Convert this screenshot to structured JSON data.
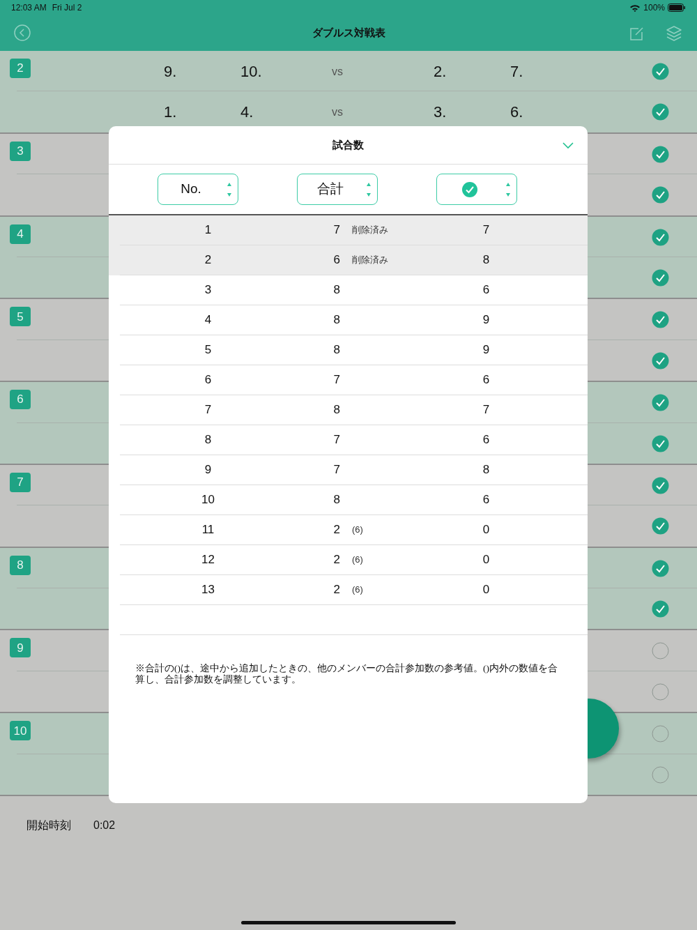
{
  "status_bar": {
    "time": "12:03 AM",
    "date": "Fri Jul 2",
    "battery": "100%"
  },
  "nav": {
    "title": "ダブルス対戦表"
  },
  "matches": [
    {
      "number": "2",
      "shaded": true,
      "rows": [
        {
          "players": [
            "9.",
            "10."
          ],
          "vs": "vs",
          "opponents": [
            "2.",
            "7."
          ],
          "done": true
        },
        {
          "players": [
            "1.",
            "4."
          ],
          "vs": "vs",
          "opponents": [
            "3.",
            "6."
          ],
          "done": true
        }
      ]
    },
    {
      "number": "3",
      "shaded": false,
      "rows": [
        {
          "done": true
        },
        {
          "done": true
        }
      ]
    },
    {
      "number": "4",
      "shaded": true,
      "rows": [
        {
          "done": true
        },
        {
          "done": true
        }
      ]
    },
    {
      "number": "5",
      "shaded": false,
      "rows": [
        {
          "done": true
        },
        {
          "done": true
        }
      ]
    },
    {
      "number": "6",
      "shaded": true,
      "rows": [
        {
          "done": true
        },
        {
          "done": true
        }
      ]
    },
    {
      "number": "7",
      "shaded": false,
      "rows": [
        {
          "done": true
        },
        {
          "done": true
        }
      ]
    },
    {
      "number": "8",
      "shaded": true,
      "rows": [
        {
          "done": true
        },
        {
          "done": true
        }
      ]
    },
    {
      "number": "9",
      "shaded": false,
      "rows": [
        {
          "done": false
        },
        {
          "done": false
        }
      ]
    },
    {
      "number": "10",
      "shaded": true,
      "rows": [
        {
          "done": false
        },
        {
          "done": false
        }
      ]
    }
  ],
  "footer": {
    "label": "開始時刻",
    "value": "0:02"
  },
  "dialog": {
    "title": "試合数",
    "sort_buttons": [
      {
        "kind": "text",
        "label": "No."
      },
      {
        "kind": "text",
        "label": "合計"
      },
      {
        "kind": "check"
      }
    ],
    "rows": [
      {
        "no": "1",
        "total": "7",
        "note": "削除済み",
        "played": "7",
        "deleted": true
      },
      {
        "no": "2",
        "total": "6",
        "note": "削除済み",
        "played": "8",
        "deleted": true
      },
      {
        "no": "3",
        "total": "8",
        "played": "6",
        "deleted": false
      },
      {
        "no": "4",
        "total": "8",
        "played": "9",
        "deleted": false
      },
      {
        "no": "5",
        "total": "8",
        "played": "9",
        "deleted": false
      },
      {
        "no": "6",
        "total": "7",
        "played": "6",
        "deleted": false
      },
      {
        "no": "7",
        "total": "8",
        "played": "7",
        "deleted": false
      },
      {
        "no": "8",
        "total": "7",
        "played": "6",
        "deleted": false
      },
      {
        "no": "9",
        "total": "7",
        "played": "8",
        "deleted": false
      },
      {
        "no": "10",
        "total": "8",
        "played": "6",
        "deleted": false
      },
      {
        "no": "11",
        "total": "2",
        "note": "(6)",
        "played": "0",
        "deleted": false
      },
      {
        "no": "12",
        "total": "2",
        "note": "(6)",
        "played": "0",
        "deleted": false
      },
      {
        "no": "13",
        "total": "2",
        "note": "(6)",
        "played": "0",
        "deleted": false
      }
    ],
    "footnote": "※合計の()は、途中から追加したときの、他のメンバーの合計参加数の参考値。()内外の数値を合算し、合計参加数を調整しています。"
  }
}
